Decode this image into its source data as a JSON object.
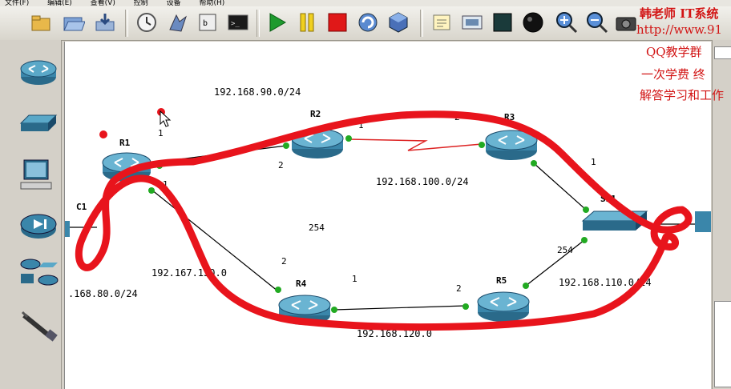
{
  "menu": {
    "items": [
      "文件(F)",
      "编辑(E)",
      "查看(V)",
      "控制",
      "设备",
      "帮助(H)"
    ]
  },
  "toolbar": {
    "buttons": [
      "new-folder-icon",
      "open-folder-icon",
      "save-icon",
      "snapshot-icon",
      "console-icon",
      "terminal-icon",
      "start-icon",
      "pause-icon",
      "stop-icon",
      "reload-icon",
      "virtualbox-icon",
      "note-icon",
      "image-icon",
      "rectangle-icon",
      "ellipse-icon",
      "zoom-in-icon",
      "zoom-out-icon",
      "camera-icon"
    ]
  },
  "devices_panel": {
    "items": [
      "router-icon",
      "switch-icon",
      "pc-icon",
      "media-device-icon",
      "all-devices-icon",
      "cable-icon"
    ]
  },
  "overlay": {
    "line1": "韩老师 IT系统",
    "line2": "http://www.91",
    "line3": "QQ教学群",
    "line4": "一次学费  终",
    "line5": "解答学习和工作"
  },
  "topology": {
    "routers": [
      {
        "id": "R1",
        "label": "R1"
      },
      {
        "id": "R2",
        "label": "R2"
      },
      {
        "id": "R3",
        "label": "R3"
      },
      {
        "id": "R4",
        "label": "R4"
      },
      {
        "id": "R5",
        "label": "R5"
      }
    ],
    "switch_label": "SW1",
    "networks": {
      "n90": "192.168.90.0/24",
      "n100": "192.168.100.0/24",
      "n130": "192.167.130.0",
      "n80": ".168.80.0/24",
      "n110": "192.168.110.0/24",
      "n120": "192.168.120.0"
    },
    "ports": {
      "r1_r2": "1",
      "r2_r1": "2",
      "r2_r3": "1",
      "r3_r2": "2",
      "r3_sw": "1",
      "r1_r4": "1",
      "r4_r1": "2",
      "r4_r5": "1",
      "r5_r4": "2",
      "sw_254": "254",
      "r5_sw": "254",
      "c_label": "C1"
    }
  },
  "colors": {
    "annotation": "#e8141c",
    "link_ok": "#22aa22",
    "link_serial": "#dd2222"
  }
}
